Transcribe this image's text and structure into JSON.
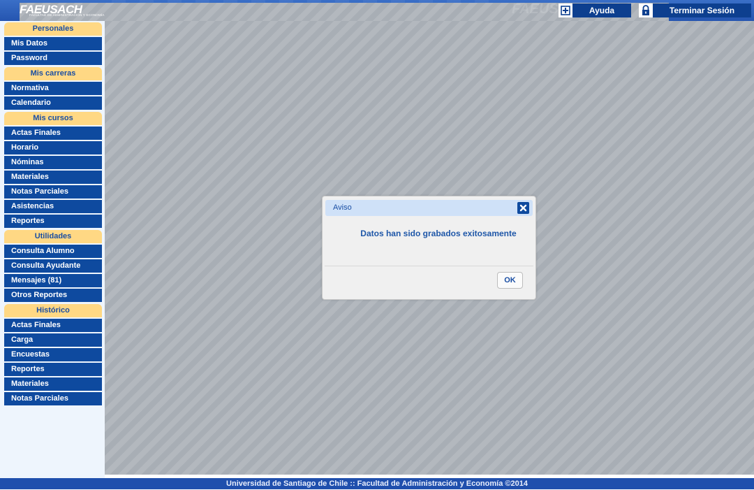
{
  "header": {
    "logo_text": "FAEUSACH",
    "logo_subtitle": "FACULTAD DE ADMINISTRACIÓN Y ECONOMÍA",
    "help_label": "Ayuda",
    "logout_label": "Terminar Sesión",
    "help_icon": "plus-box-icon",
    "logout_icon": "lock-icon"
  },
  "sidebar": {
    "personales": {
      "title": "Personales",
      "items": [
        "Mis Datos",
        "Password"
      ]
    },
    "carreras": {
      "title": "Mis carreras",
      "items": [
        "Normativa",
        "Calendario"
      ]
    },
    "cursos": {
      "title": "Mis cursos",
      "items": [
        "Actas Finales",
        "Horario",
        "Nóminas",
        "Materiales",
        "Notas Parciales",
        "Asistencias",
        "Reportes"
      ]
    },
    "utilidades": {
      "title": "Utilidades",
      "items": [
        "Consulta Alumno",
        "Consulta Ayudante",
        "Mensajes (81)",
        "Otros Reportes"
      ]
    },
    "historico": {
      "title": "Histórico",
      "items": [
        "Actas Finales",
        "Carga",
        "Encuestas",
        "Reportes",
        "Materiales",
        "Notas Parciales"
      ]
    }
  },
  "dialog": {
    "title": "Aviso",
    "message": "Datos han sido grabados exitosamente",
    "ok_label": "OK",
    "close_icon": "close-icon"
  },
  "footer": {
    "text": "Universidad de Santiago de Chile :: Facultad de Administración y Economía ©2014"
  },
  "colors": {
    "nav_blue": "#0e4a9f",
    "section_yellow": "#ffd884",
    "header_blue": "#2555b0"
  }
}
